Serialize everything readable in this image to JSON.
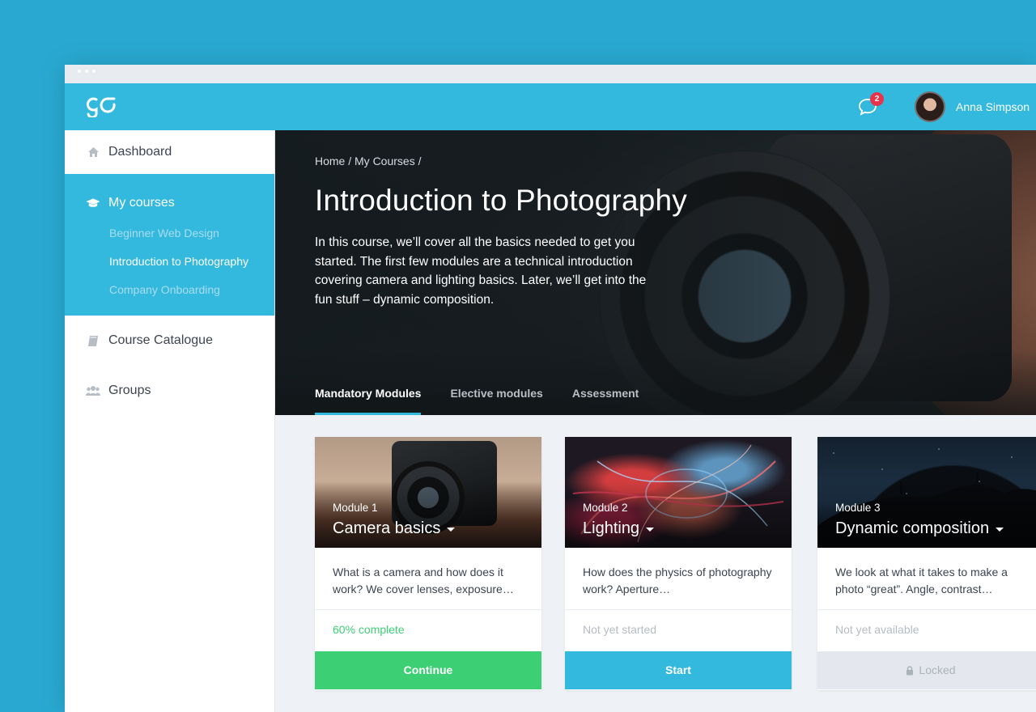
{
  "header": {
    "notification_count": "2",
    "user_name": "Anna Simpson"
  },
  "sidebar": {
    "dashboard": "Dashboard",
    "my_courses": "My courses",
    "courses": [
      "Beginner Web Design",
      "Introduction to Photography",
      "Company Onboarding"
    ],
    "active_course_index": 1,
    "course_catalogue": "Course Catalogue",
    "groups": "Groups"
  },
  "hero": {
    "breadcrumb": "Home / My Courses /",
    "title": "Introduction to Photography",
    "description": "In this course, we’ll cover all the basics needed to get you started. The first few modules are a technical introduction covering camera and lighting basics. Later, we’ll get into the fun stuff – dynamic composition.",
    "tabs": [
      "Mandatory Modules",
      "Elective modules",
      "Assessment"
    ],
    "active_tab": 0
  },
  "modules": [
    {
      "number": "Module 1",
      "title": "Camera basics",
      "description": "What is a camera and how does it work? We cover lenses, exposure…",
      "status": "60% complete",
      "progress": 0.6,
      "button": "Continue"
    },
    {
      "number": "Module 2",
      "title": "Lighting",
      "description": "How does the physics of photography work? Aperture…",
      "status": "Not yet started",
      "button": "Start"
    },
    {
      "number": "Module 3",
      "title": "Dynamic composition",
      "description": "We look at what it takes to make a photo “great”. Angle, contrast…",
      "status": "Not yet available",
      "button": "Locked"
    }
  ],
  "colors": {
    "background": "#29a9d2",
    "brand_blue": "#33b8de",
    "success_green": "#3ccf74",
    "badge_red": "#e8334a",
    "locked_grey": "#e4e8ee"
  },
  "icons": [
    "logo-go",
    "chat-bubble-icon",
    "home-icon",
    "graduation-cap-icon",
    "book-icon",
    "users-icon",
    "lock-icon",
    "chevron-down-icon"
  ]
}
